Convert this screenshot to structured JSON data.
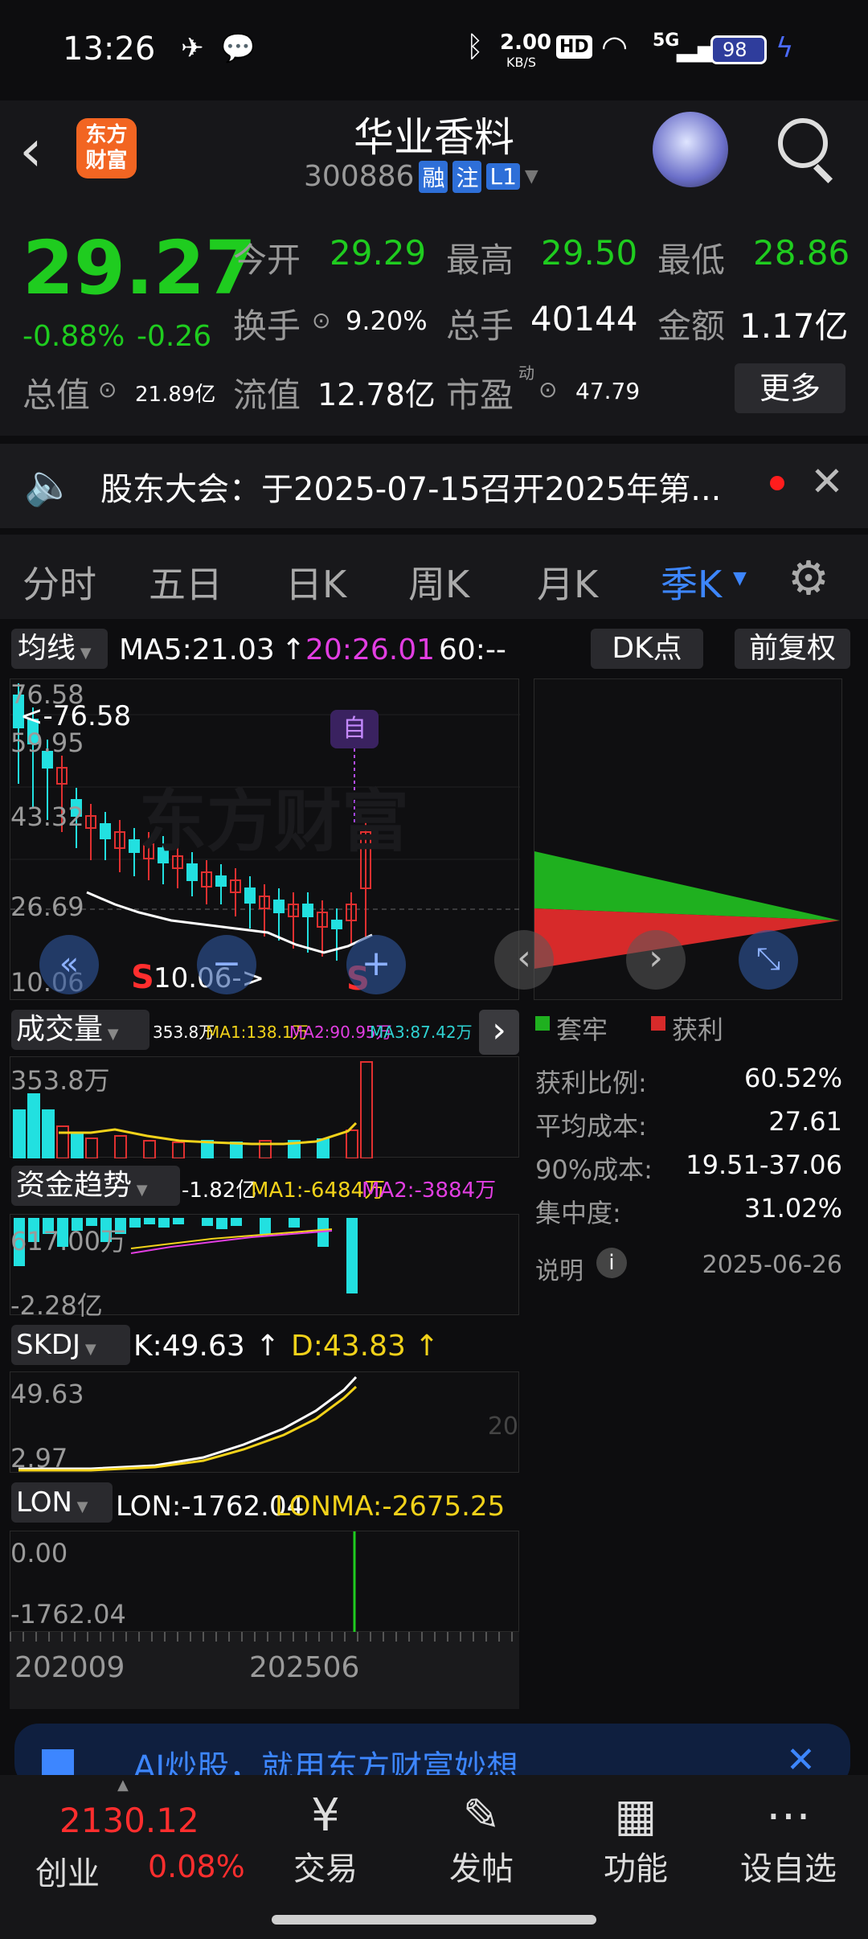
{
  "status": {
    "time": "13:26",
    "net_speed_value": "2.00",
    "net_speed_unit": "KB/S",
    "hd": "HD",
    "signal": "5G",
    "battery": "98"
  },
  "header": {
    "app_logo_text": "东方财富",
    "stock_name": "华业香料",
    "stock_code": "300886",
    "tags": [
      "融",
      "注",
      "L1"
    ]
  },
  "quote": {
    "price": "29.27",
    "change_pct": "-0.88%",
    "change": "-0.26",
    "fields": {
      "open_label": "今开",
      "open": "29.29",
      "high_label": "最高",
      "high": "29.50",
      "low_label": "最低",
      "low": "28.86",
      "turnover_label": "换手",
      "turnover": "9.20%",
      "volume_label": "总手",
      "volume": "40144",
      "amount_label": "金额",
      "amount": "1.17亿",
      "mktcap_label": "总值",
      "mktcap": "21.89亿",
      "float_label": "流值",
      "float": "12.78亿",
      "pe_label": "市盈",
      "pe_sup": "动",
      "pe": "47.79"
    },
    "more_button": "更多"
  },
  "notice": {
    "text": "股东大会：于2025-07-15召开2025年第..."
  },
  "tabs": [
    {
      "label": "分时",
      "active": false
    },
    {
      "label": "五日",
      "active": false
    },
    {
      "label": "日K",
      "active": false
    },
    {
      "label": "周K",
      "active": false
    },
    {
      "label": "月K",
      "active": false
    },
    {
      "label": "季K",
      "active": true
    }
  ],
  "ma_bar": {
    "selector": "均线",
    "ma5": "MA5:21.03",
    "ma20": "20:26.01",
    "ma60": "60:--",
    "dk": "DK点",
    "adjust": "前复权"
  },
  "kline": {
    "labels_y": [
      "76.58",
      "59.95",
      "43.32",
      "26.69",
      "10.06"
    ],
    "max_marker": "<-76.58",
    "min_marker": "10.06->",
    "self_tag": "自",
    "signal_s": "S",
    "watermark": "东方财富"
  },
  "chip": {
    "legend_trapped": "套牢",
    "legend_profit": "获利",
    "rows": [
      {
        "label": "获利比例:",
        "value": "60.52%"
      },
      {
        "label": "平均成本:",
        "value": "27.61"
      },
      {
        "label": "90%成本:",
        "value": "19.51-37.06"
      },
      {
        "label": "集中度:",
        "value": "31.02%"
      }
    ],
    "explain": "说明",
    "date": "2025-06-26"
  },
  "volume": {
    "selector": "成交量",
    "vol": "353.8万",
    "ma1": "MA1:138.1万",
    "ma2": "MA2:90.95万",
    "ma3": "MA3:87.42万",
    "axis_top": "353.8万"
  },
  "fund": {
    "selector": "资金趋势",
    "val": "-1.82亿",
    "ma1": "MA1:-6484万",
    "ma2": "MA2:-3884万",
    "axis_top": "617.00万",
    "axis_bottom": "-2.28亿"
  },
  "skdj": {
    "selector": "SKDJ",
    "k": "K:49.63",
    "d": "D:43.83",
    "axis_top": "49.63",
    "axis_bottom": "2.97",
    "ref": "20"
  },
  "lon": {
    "selector": "LON",
    "lon": "LON:-1762.04",
    "lonma": "LONMA:-2675.25",
    "axis_top": "0.00",
    "axis_bottom": "-1762.04"
  },
  "xaxis": [
    "202009",
    "202506"
  ],
  "ad": {
    "text": "AI炒股，就用东方财富妙想"
  },
  "bottom_nav": {
    "index_value": "2130.12",
    "index_name": "创业",
    "index_change": "0.08%",
    "items": [
      "交易",
      "发帖",
      "功能",
      "设自选"
    ]
  }
}
